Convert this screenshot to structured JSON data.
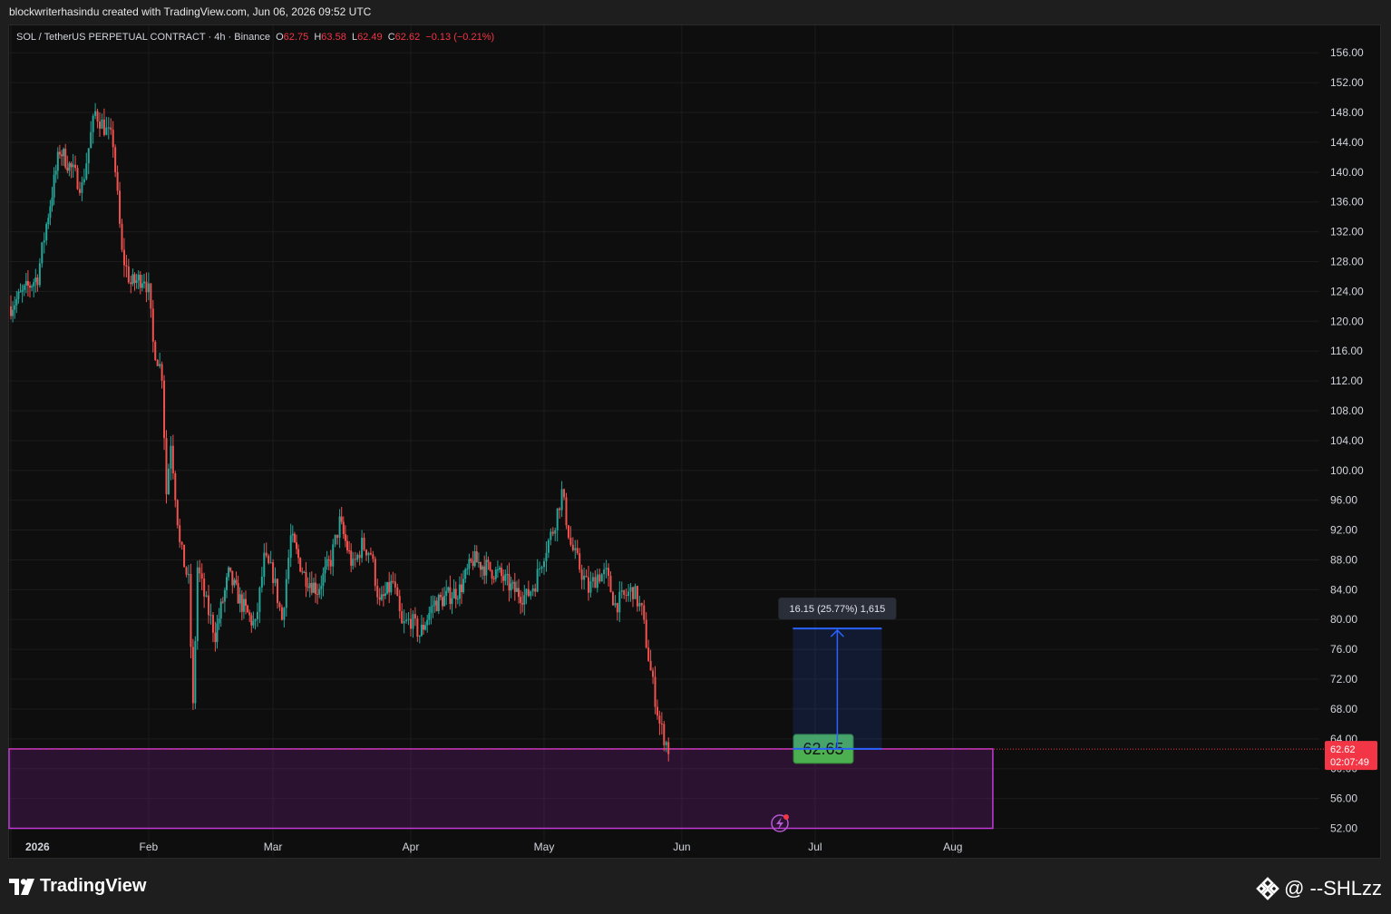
{
  "caption": "blockwriterhasindu created with TradingView.com, Jun 06, 2026 09:52 UTC",
  "legend": {
    "symbol": "SOL / TetherUS PERPETUAL CONTRACT · 4h · Binance",
    "o_label": "O",
    "o_val": "62.75",
    "h_label": "H",
    "h_val": "63.58",
    "l_label": "L",
    "l_val": "62.49",
    "c_label": "C",
    "c_val": "62.62",
    "change": "−0.13 (−0.21%)"
  },
  "footer": {
    "brand": "TradingView",
    "handle": "@ --SHLzz"
  },
  "colors": {
    "up": "#26a69a",
    "down": "#ef5350",
    "zone": "#c03ad6",
    "measure": "#2962ff",
    "price_tag": "#f23645",
    "label_green": "#4caf50"
  },
  "chart_data": {
    "type": "candlestick",
    "symbol": "SOL / TetherUS PERPETUAL CONTRACT",
    "interval": "4h",
    "exchange": "Binance",
    "y_ticks": [
      52,
      56,
      60,
      64,
      68,
      72,
      76,
      80,
      84,
      88,
      92,
      96,
      100,
      104,
      108,
      112,
      116,
      120,
      124,
      128,
      132,
      136,
      140,
      144,
      148,
      152,
      156
    ],
    "y_tick_labels": [
      "52.00",
      "56.00",
      "60.00",
      "64.00",
      "68.00",
      "72.00",
      "76.00",
      "80.00",
      "84.00",
      "88.00",
      "92.00",
      "96.00",
      "100.00",
      "104.00",
      "108.00",
      "112.00",
      "116.00",
      "120.00",
      "124.00",
      "128.00",
      "132.00",
      "136.00",
      "140.00",
      "144.00",
      "148.00",
      "152.00",
      "156.00"
    ],
    "x_ticks": [
      "2026",
      "Feb",
      "Mar",
      "Apr",
      "May",
      "Jun",
      "Jul",
      "Aug"
    ],
    "x_tick_days": [
      0,
      31,
      59,
      90,
      120,
      151,
      181,
      212
    ],
    "price_path": [
      [
        0,
        122
      ],
      [
        3,
        124
      ],
      [
        6,
        126
      ],
      [
        8,
        133
      ],
      [
        11,
        143
      ],
      [
        14,
        140
      ],
      [
        16,
        138
      ],
      [
        18,
        145
      ],
      [
        19,
        148
      ],
      [
        21,
        146
      ],
      [
        23,
        144
      ],
      [
        25,
        129
      ],
      [
        27,
        125
      ],
      [
        30,
        126
      ],
      [
        31,
        124
      ],
      [
        32,
        117
      ],
      [
        34,
        113
      ],
      [
        35,
        97
      ],
      [
        36,
        104
      ],
      [
        38,
        90
      ],
      [
        40,
        85
      ],
      [
        41,
        68
      ],
      [
        42,
        87
      ],
      [
        44,
        82
      ],
      [
        46,
        78
      ],
      [
        49,
        86
      ],
      [
        52,
        82
      ],
      [
        55,
        79
      ],
      [
        57,
        88
      ],
      [
        59,
        86
      ],
      [
        61,
        80
      ],
      [
        63,
        91
      ],
      [
        66,
        86
      ],
      [
        69,
        84
      ],
      [
        72,
        88
      ],
      [
        74,
        93
      ],
      [
        77,
        87
      ],
      [
        79,
        90
      ],
      [
        81,
        89
      ],
      [
        83,
        82
      ],
      [
        86,
        85
      ],
      [
        88,
        79
      ],
      [
        90,
        80
      ],
      [
        92,
        78
      ],
      [
        95,
        82
      ],
      [
        98,
        83
      ],
      [
        101,
        84
      ],
      [
        104,
        88
      ],
      [
        107,
        87
      ],
      [
        110,
        86
      ],
      [
        113,
        84
      ],
      [
        116,
        83
      ],
      [
        118,
        85
      ],
      [
        120,
        89
      ],
      [
        122,
        92
      ],
      [
        124,
        97
      ],
      [
        126,
        90
      ],
      [
        128,
        87
      ],
      [
        130,
        84
      ],
      [
        132,
        86
      ],
      [
        134,
        86
      ],
      [
        136,
        82
      ],
      [
        138,
        83
      ],
      [
        140,
        84
      ],
      [
        142,
        81
      ],
      [
        144,
        73
      ],
      [
        146,
        66
      ],
      [
        148,
        62.62
      ]
    ],
    "last_price": "62.62",
    "countdown": "02:07:49",
    "level_label": "62.65",
    "measure": {
      "label": "16.15 (25.77%) 1,615",
      "from_price": 62.65,
      "to_price": 78.8,
      "from_day": 176,
      "to_day": 196
    },
    "zone": {
      "top": 62.65,
      "bottom": 52.0,
      "from_day": 0,
      "to_day": 221
    }
  }
}
